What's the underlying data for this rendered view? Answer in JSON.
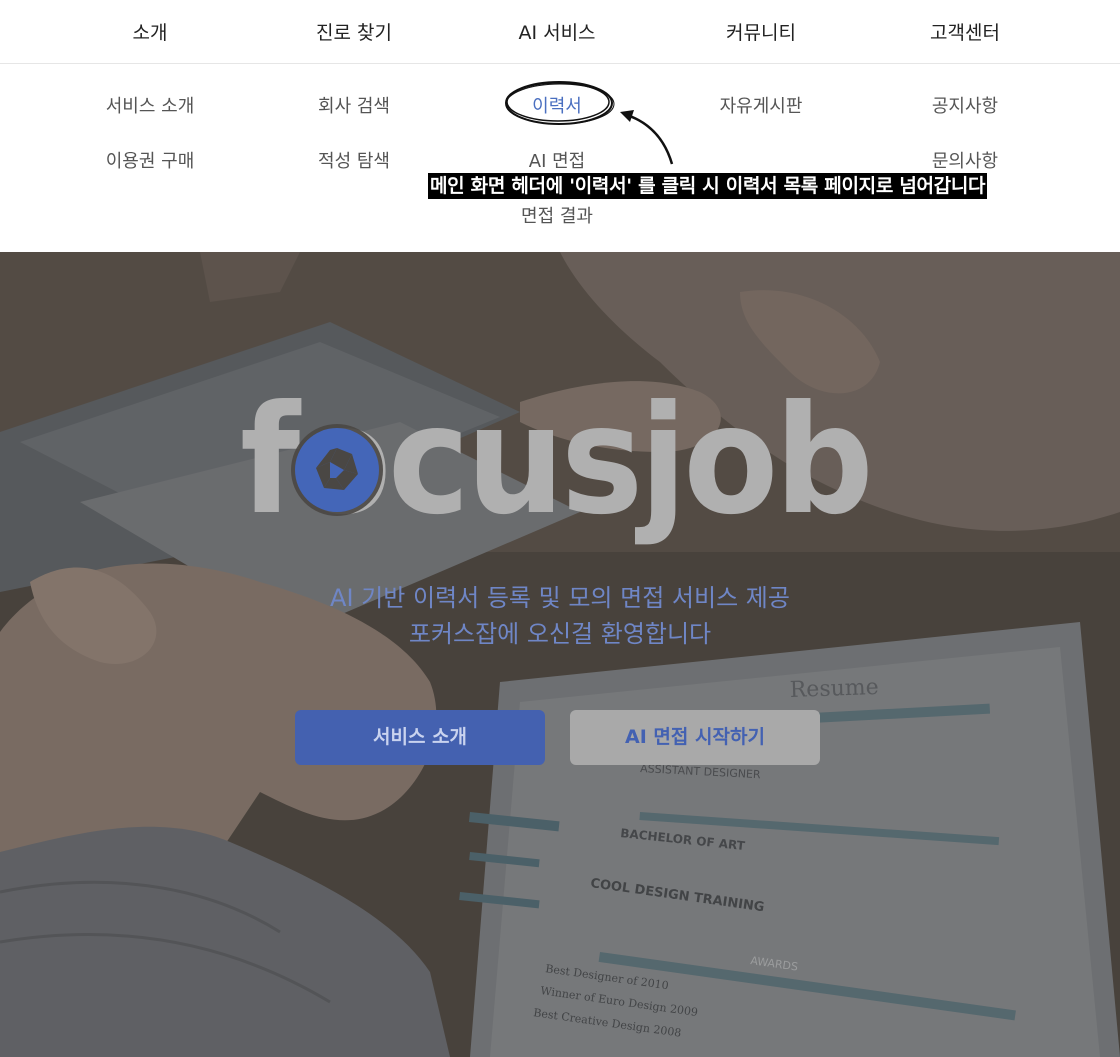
{
  "nav": {
    "items": [
      "소개",
      "진로 찾기",
      "AI 서비스",
      "커뮤니티",
      "고객센터"
    ]
  },
  "submenu": {
    "intro": [
      "서비스 소개",
      "이용권 구매"
    ],
    "career": [
      "회사 검색",
      "적성 탐색"
    ],
    "ai": [
      "이력서",
      "AI 면접",
      "면접 결과"
    ],
    "community": [
      "자유게시판"
    ],
    "support": [
      "공지사항",
      "문의사항"
    ]
  },
  "annotation": {
    "note": "메인 화면 헤더에 '이력서' 를 클릭 시 이력서 목록 페이지로 넘어갑니다"
  },
  "hero": {
    "logo_text": "focusjob",
    "tagline_line1": "AI 기반 이력서 등록 및 모의 면접 서비스 제공",
    "tagline_line2": "포커스잡에 오신걸 환영합니다",
    "primary_button": "서비스 소개",
    "secondary_button": "AI 면접 시작하기",
    "doc_texts": [
      "Resume",
      "ASSISTANT DESIGNER",
      "BACHELOR OF ART",
      "COOL DESIGN TRAINING",
      "AWARDS",
      "Best Designer of 2010",
      "Winner of Euro Design 2009",
      "Best Creative Design 2008"
    ]
  },
  "colors": {
    "accent": "#4461b0",
    "tagline": "#6f86c6",
    "secondary_btn": "#a9a9a9"
  }
}
